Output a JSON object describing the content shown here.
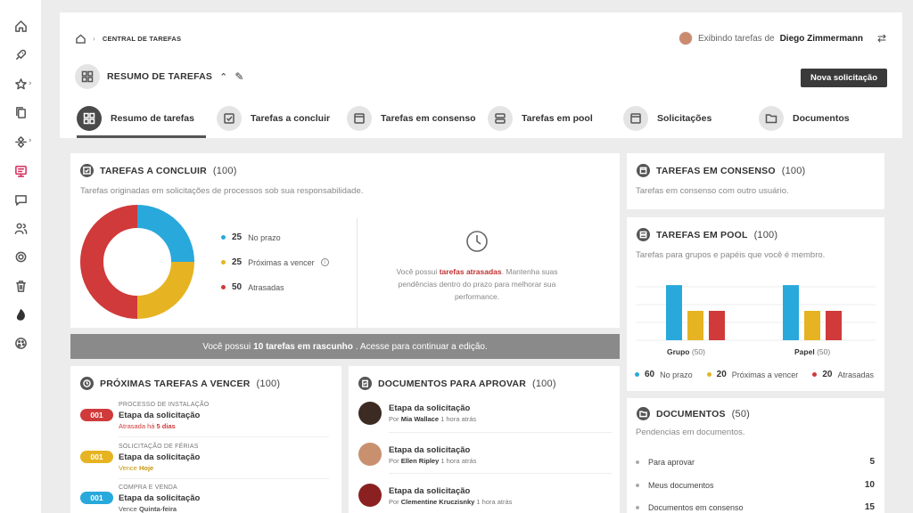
{
  "sidebar": {
    "items": [
      {
        "name": "home-icon"
      },
      {
        "name": "rocket-icon"
      },
      {
        "name": "star-icon"
      },
      {
        "name": "copy-icon"
      },
      {
        "name": "network-icon"
      },
      {
        "name": "task-board-icon"
      },
      {
        "name": "chat-icon"
      },
      {
        "name": "users-icon"
      },
      {
        "name": "settings-icon"
      },
      {
        "name": "trash-icon"
      },
      {
        "name": "flame-icon"
      },
      {
        "name": "palette-icon"
      }
    ],
    "active_color": "#d42a5c"
  },
  "header": {
    "breadcrumb": "CENTRAL DE TAREFAS",
    "viewer_prefix": "Exibindo tarefas de",
    "viewer_name": "Diego Zimmermann",
    "section_title": "RESUMO DE TAREFAS",
    "new_button": "Nova solicitação"
  },
  "tabs": [
    {
      "label": "Resumo de tarefas",
      "active": true
    },
    {
      "label": "Tarefas a concluir"
    },
    {
      "label": "Tarefas em consenso"
    },
    {
      "label": "Tarefas em pool"
    },
    {
      "label": "Solicitações"
    },
    {
      "label": "Documentos"
    }
  ],
  "colors": {
    "blue": "#29a8dc",
    "yellow": "#e6b422",
    "red": "#d03a3a"
  },
  "concluir": {
    "title": "TAREFAS A CONCLUIR",
    "count": "(100)",
    "desc": "Tarefas originadas em solicitações de processos sob sua responsabilidade.",
    "legend": [
      {
        "value": "25",
        "label": "No prazo"
      },
      {
        "value": "25",
        "label": "Próximas a vencer"
      },
      {
        "value": "50",
        "label": "Atrasadas"
      }
    ],
    "late_text_1": "Você possui",
    "late_text_red": "tarefas atrasadas",
    "late_text_2": ". Mantenha suas pendências dentro do prazo para melhorar sua performance."
  },
  "chart_data": [
    {
      "type": "pie",
      "title": "TAREFAS A CONCLUIR",
      "categories": [
        "No prazo",
        "Próximas a vencer",
        "Atrasadas"
      ],
      "values": [
        25,
        25,
        50
      ],
      "colors": [
        "#29a8dc",
        "#e6b422",
        "#d03a3a"
      ]
    },
    {
      "type": "bar",
      "title": "TAREFAS EM POOL",
      "categories": [
        "Grupo",
        "Papel"
      ],
      "series": [
        {
          "name": "No prazo",
          "values": [
            30,
            30
          ],
          "color": "#29a8dc"
        },
        {
          "name": "Próximas a vencer",
          "values": [
            16,
            16
          ],
          "color": "#e6b422"
        },
        {
          "name": "Atrasadas",
          "values": [
            16,
            16
          ],
          "color": "#d03a3a"
        }
      ]
    }
  ],
  "banner": {
    "prefix": "Você possui",
    "bold": "10 tarefas em rascunho",
    "suffix": ". Acesse para continuar a edição."
  },
  "proximas": {
    "title": "PRÓXIMAS TAREFAS A VENCER",
    "count": "(100)",
    "items": [
      {
        "badge": "001",
        "color": "#d03a3a",
        "process": "PROCESSO DE INSTALAÇÃO",
        "name": "Etapa da solicitação",
        "due_prefix": "Atrasada há",
        "due_bold": "5 dias",
        "due_color": "#d03a3a"
      },
      {
        "badge": "001",
        "color": "#e6b422",
        "process": "SOLICITAÇÃO DE FÉRIAS",
        "name": "Etapa da solicitação",
        "due_prefix": "Vence",
        "due_bold": "Hoje",
        "due_color": "#c8960a"
      },
      {
        "badge": "001",
        "color": "#29a8dc",
        "process": "COMPRA E VENDA",
        "name": "Etapa da solicitação",
        "due_prefix": "Vence",
        "due_bold": "Quinta-feira",
        "due_color": "#555"
      }
    ]
  },
  "docs_aprovar": {
    "title": "DOCUMENTOS PARA APROVAR",
    "count": "(100)",
    "items": [
      {
        "name": "Etapa da solicitação",
        "by_prefix": "Por",
        "author": "Mia Wallace",
        "time": "1 hora atrás",
        "avatar": "#3b2b22"
      },
      {
        "name": "Etapa da solicitação",
        "by_prefix": "Por",
        "author": "Ellen Ripley",
        "time": "1 hora atrás",
        "avatar": "#c99070"
      },
      {
        "name": "Etapa da solicitação",
        "by_prefix": "Por",
        "author": "Clementine Kruczisnky",
        "time": "1 hora atrás",
        "avatar": "#8a2020"
      }
    ]
  },
  "consenso": {
    "title": "TAREFAS EM CONSENSO",
    "count": "(100)",
    "desc": "Tarefas em consenso com outro usuário."
  },
  "pool": {
    "title": "TAREFAS EM POOL",
    "count": "(100)",
    "desc": "Tarefas para grupos e papéis que você é membro.",
    "groups": [
      {
        "label": "Grupo",
        "count": "(50)"
      },
      {
        "label": "Papel",
        "count": "(50)"
      }
    ],
    "legend": [
      {
        "value": "60",
        "label": "No prazo"
      },
      {
        "value": "20",
        "label": "Próximas a vencer"
      },
      {
        "value": "20",
        "label": "Atrasadas"
      }
    ]
  },
  "documentos": {
    "title": "DOCUMENTOS",
    "count": "(50)",
    "desc": "Pendencias em documentos.",
    "rows": [
      {
        "label": "Para aprovar",
        "value": "5"
      },
      {
        "label": "Meus documentos",
        "value": "10"
      },
      {
        "label": "Documentos em consenso",
        "value": "15"
      }
    ]
  }
}
